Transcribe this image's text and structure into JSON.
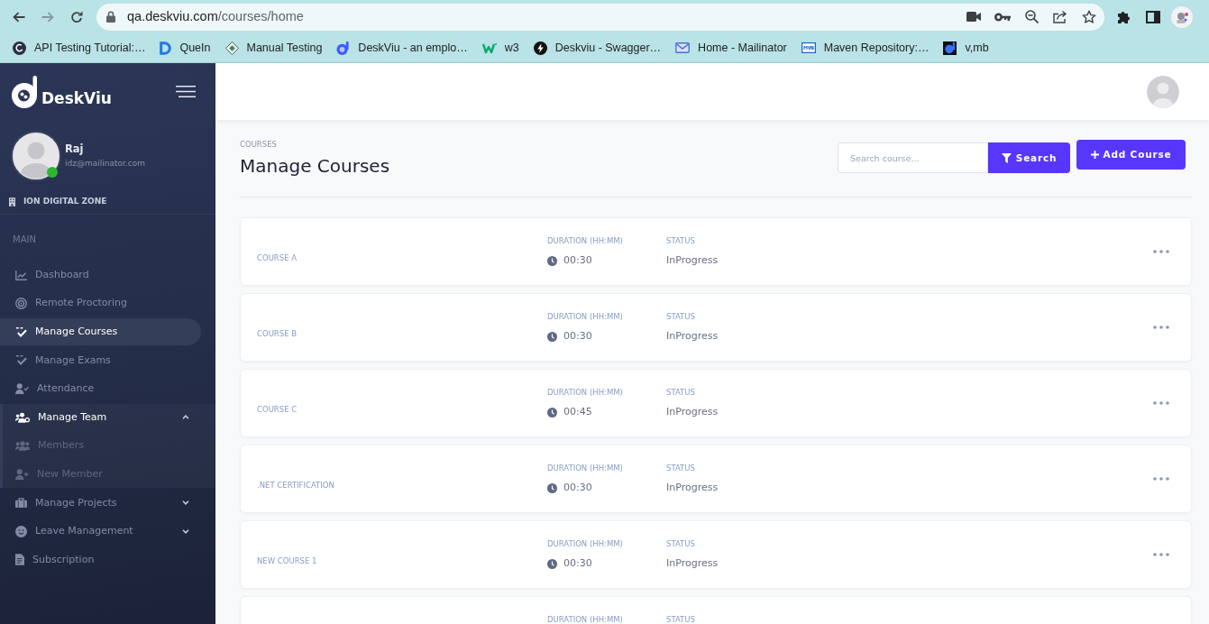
{
  "browser": {
    "forward_disabled": true,
    "url_host": "qa.deskviu.com",
    "url_path": "/courses/home",
    "bookmarks": [
      {
        "label": "API Testing Tutorial:…"
      },
      {
        "label": "QueIn"
      },
      {
        "label": "Manual Testing"
      },
      {
        "label": "DeskViu - an emplo…"
      },
      {
        "label": "w3"
      },
      {
        "label": "Deskviu - Swagger…"
      },
      {
        "label": "Home - Mailinator"
      },
      {
        "label": "Maven Repository:…"
      },
      {
        "label": "v,mb"
      }
    ]
  },
  "sidebar": {
    "logo_text": "DeskViu",
    "user": {
      "name": "Raj",
      "email": "idz@mailinator.com",
      "online": true
    },
    "organization": "ION DIGITAL ZONE",
    "section_label": "MAIN",
    "nav": [
      {
        "label": "Dashboard",
        "kind": "link",
        "selected": false
      },
      {
        "label": "Remote Proctoring",
        "kind": "link",
        "selected": false
      },
      {
        "label": "Manage Courses",
        "kind": "link",
        "selected": true
      },
      {
        "label": "Manage Exams",
        "kind": "link",
        "selected": false
      },
      {
        "label": "Attendance",
        "kind": "link",
        "selected": false
      },
      {
        "label": "Manage Team",
        "kind": "group",
        "selected": false,
        "expanded": true,
        "children": [
          {
            "label": "Members",
            "selected": false
          },
          {
            "label": "New Member",
            "selected": false
          }
        ]
      },
      {
        "label": "Manage Projects",
        "kind": "group",
        "selected": false,
        "expanded": false
      },
      {
        "label": "Leave Management",
        "kind": "group",
        "selected": false,
        "expanded": false
      },
      {
        "label": "Subscription",
        "kind": "link",
        "selected": false
      }
    ]
  },
  "page": {
    "breadcrumb": "COURSES",
    "title": "Manage Courses",
    "search": {
      "placeholder": "Search course..."
    },
    "search_button": "Search",
    "add_button": "Add Course"
  },
  "courses": [
    {
      "name": "COURSE A",
      "duration_label": "DURATION (HH:MM)",
      "duration": "00:30",
      "status_label": "STATUS",
      "status": "InProgress"
    },
    {
      "name": "COURSE B",
      "duration_label": "DURATION (HH:MM)",
      "duration": "00:30",
      "status_label": "STATUS",
      "status": "InProgress"
    },
    {
      "name": "COURSE C",
      "duration_label": "DURATION (HH:MM)",
      "duration": "00:45",
      "status_label": "STATUS",
      "status": "InProgress"
    },
    {
      "name": ".NET CERTIFICATION",
      "duration_label": "DURATION (HH:MM)",
      "duration": "00:30",
      "status_label": "STATUS",
      "status": "InProgress"
    },
    {
      "name": "NEW COURSE 1",
      "duration_label": "DURATION (HH:MM)",
      "duration": "00:30",
      "status_label": "STATUS",
      "status": "InProgress"
    },
    {
      "duration_label": "DURATION (HH:MM)",
      "status_label": "STATUS"
    }
  ]
}
